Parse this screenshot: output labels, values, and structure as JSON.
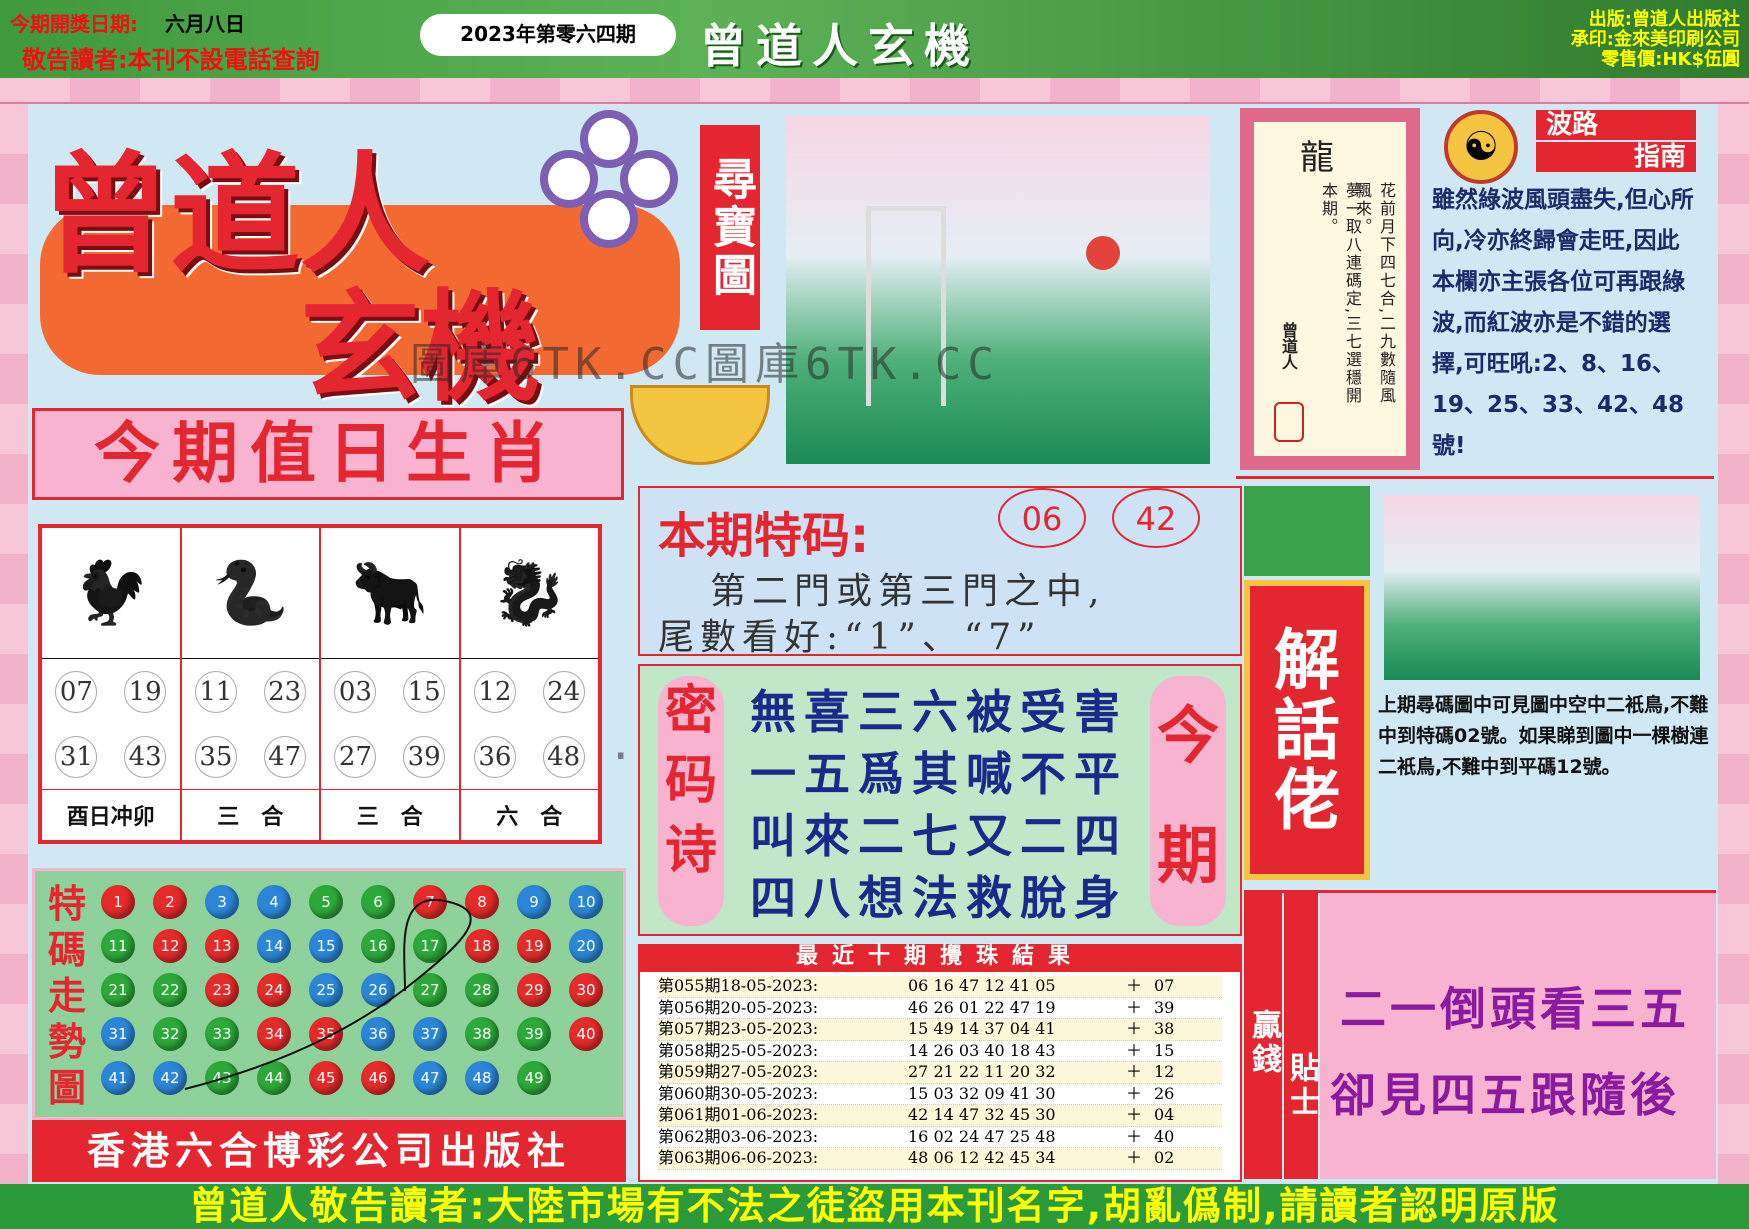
{
  "header": {
    "issue_date_label": "今期開獎日期:",
    "issue_date": "六月八日",
    "notice": "敬告讀者:本刊不設電話查詢",
    "issue_number": "2023年第零六四期",
    "brand": "曾道人玄機",
    "publisher": "出版:曾道人出版社",
    "printer": "承印:金來美印刷公司",
    "price": "零售價:HK$伍圓"
  },
  "masthead": {
    "line1": "曾道人",
    "line2": "玄機",
    "treasure": "尋寶圖"
  },
  "watermark": "圖庫6TK.CC圖庫6TK.CC",
  "zodiac": {
    "title": "今期值日生肖",
    "groups": [
      {
        "icon": "rooster-icon",
        "glyph": "🐓",
        "numbers": [
          "07",
          "19",
          "31",
          "43"
        ],
        "note": "酉日冲卯"
      },
      {
        "icon": "snake-icon",
        "glyph": "🐍",
        "numbers": [
          "11",
          "23",
          "35",
          "47"
        ],
        "note": "三　合"
      },
      {
        "icon": "ox-icon",
        "glyph": "🐂",
        "numbers": [
          "03",
          "15",
          "27",
          "39"
        ],
        "note": "三　合"
      },
      {
        "icon": "dragon-icon",
        "glyph": "🐉",
        "numbers": [
          "12",
          "24",
          "36",
          "48"
        ],
        "note": "六　合"
      }
    ]
  },
  "trend": {
    "title": "特碼走勢圖",
    "balls": [
      {
        "n": "1",
        "c": "red"
      },
      {
        "n": "2",
        "c": "red"
      },
      {
        "n": "3",
        "c": "blue"
      },
      {
        "n": "4",
        "c": "blue"
      },
      {
        "n": "5",
        "c": "green"
      },
      {
        "n": "6",
        "c": "green"
      },
      {
        "n": "7",
        "c": "red"
      },
      {
        "n": "8",
        "c": "red"
      },
      {
        "n": "9",
        "c": "blue"
      },
      {
        "n": "10",
        "c": "blue"
      },
      {
        "n": "11",
        "c": "green"
      },
      {
        "n": "12",
        "c": "red"
      },
      {
        "n": "13",
        "c": "red"
      },
      {
        "n": "14",
        "c": "blue"
      },
      {
        "n": "15",
        "c": "blue"
      },
      {
        "n": "16",
        "c": "green"
      },
      {
        "n": "17",
        "c": "green"
      },
      {
        "n": "18",
        "c": "red"
      },
      {
        "n": "19",
        "c": "red"
      },
      {
        "n": "20",
        "c": "blue"
      },
      {
        "n": "21",
        "c": "green"
      },
      {
        "n": "22",
        "c": "green"
      },
      {
        "n": "23",
        "c": "red"
      },
      {
        "n": "24",
        "c": "red"
      },
      {
        "n": "25",
        "c": "blue"
      },
      {
        "n": "26",
        "c": "blue"
      },
      {
        "n": "27",
        "c": "green"
      },
      {
        "n": "28",
        "c": "green"
      },
      {
        "n": "29",
        "c": "red"
      },
      {
        "n": "30",
        "c": "red"
      },
      {
        "n": "31",
        "c": "blue"
      },
      {
        "n": "32",
        "c": "green"
      },
      {
        "n": "33",
        "c": "green"
      },
      {
        "n": "34",
        "c": "red"
      },
      {
        "n": "35",
        "c": "red"
      },
      {
        "n": "36",
        "c": "blue"
      },
      {
        "n": "37",
        "c": "blue"
      },
      {
        "n": "38",
        "c": "green"
      },
      {
        "n": "39",
        "c": "green"
      },
      {
        "n": "40",
        "c": "red"
      },
      {
        "n": "41",
        "c": "blue"
      },
      {
        "n": "42",
        "c": "blue"
      },
      {
        "n": "43",
        "c": "green"
      },
      {
        "n": "44",
        "c": "green"
      },
      {
        "n": "45",
        "c": "red"
      },
      {
        "n": "46",
        "c": "red"
      },
      {
        "n": "47",
        "c": "blue"
      },
      {
        "n": "48",
        "c": "blue"
      },
      {
        "n": "49",
        "c": "green"
      }
    ]
  },
  "publisher_banner": "香港六合博彩公司出版社",
  "special": {
    "title": "本期特码:",
    "numbers": [
      "06",
      "42"
    ],
    "line1": "第二門或第三門之中,",
    "line2": "尾數看好:“1”、“7”"
  },
  "poem": {
    "left_label": "密码诗",
    "right_label": "今期",
    "lines": [
      "無喜三六被受害",
      "一五爲其喊不平",
      "叫來二七又二四",
      "四八想法救脫身"
    ]
  },
  "results": {
    "title": "最近十期攪珠結果",
    "rows": [
      {
        "id": "第055期18-05-2023:",
        "main": "06 16 47 12 41 05",
        "sp": "07"
      },
      {
        "id": "第056期20-05-2023:",
        "main": "46 26 01 22 47 19",
        "sp": "39"
      },
      {
        "id": "第057期23-05-2023:",
        "main": "15 49 14 37 04 41",
        "sp": "38"
      },
      {
        "id": "第058期25-05-2023:",
        "main": "14 26 03 40 18 43",
        "sp": "15"
      },
      {
        "id": "第059期27-05-2023:",
        "main": "27 21 22 11 20 32",
        "sp": "12"
      },
      {
        "id": "第060期30-05-2023:",
        "main": "15 03 32 09 41 30",
        "sp": "26"
      },
      {
        "id": "第061期01-06-2023:",
        "main": "42 14 47 32 45 30",
        "sp": "04"
      },
      {
        "id": "第062期03-06-2023:",
        "main": "16 02 24 47 25 48",
        "sp": "40"
      },
      {
        "id": "第063期06-06-2023:",
        "main": "48 06 12 42 45 34",
        "sp": "02"
      }
    ]
  },
  "dragon_card": {
    "title": "龍",
    "col1": "花前月下四七合,二九數隨風飄來。",
    "col2": "夢一取八連碼定,三七選穩開本期。",
    "sign": "曾道人"
  },
  "wave_guide": {
    "title1": "波路",
    "title2": "指南",
    "text": "雖然綠波風頭盡失,但心所向,冷亦終歸會走旺,因此本欄亦主張各位可再跟綠波,而紅波亦是不錯的選擇,可旺吼:2、8、16、19、25、33、42、48號!"
  },
  "jiehua": {
    "label": "解話佬",
    "text": "上期尋碼圖中可見圖中空中二衹鳥,不難中到特碼02號。如果睇到圖中一棵樹連二衹鳥,不難中到平碼12號。"
  },
  "tips": {
    "label1": "贏錢",
    "label2": "貼士",
    "line1": "二一倒頭看三五",
    "line2": "卻見四五跟隨後"
  },
  "footer": "曾道人敬告讀者:大陸市場有不法之徒盜用本刊名字,胡亂僞制,請讀者認明原版"
}
